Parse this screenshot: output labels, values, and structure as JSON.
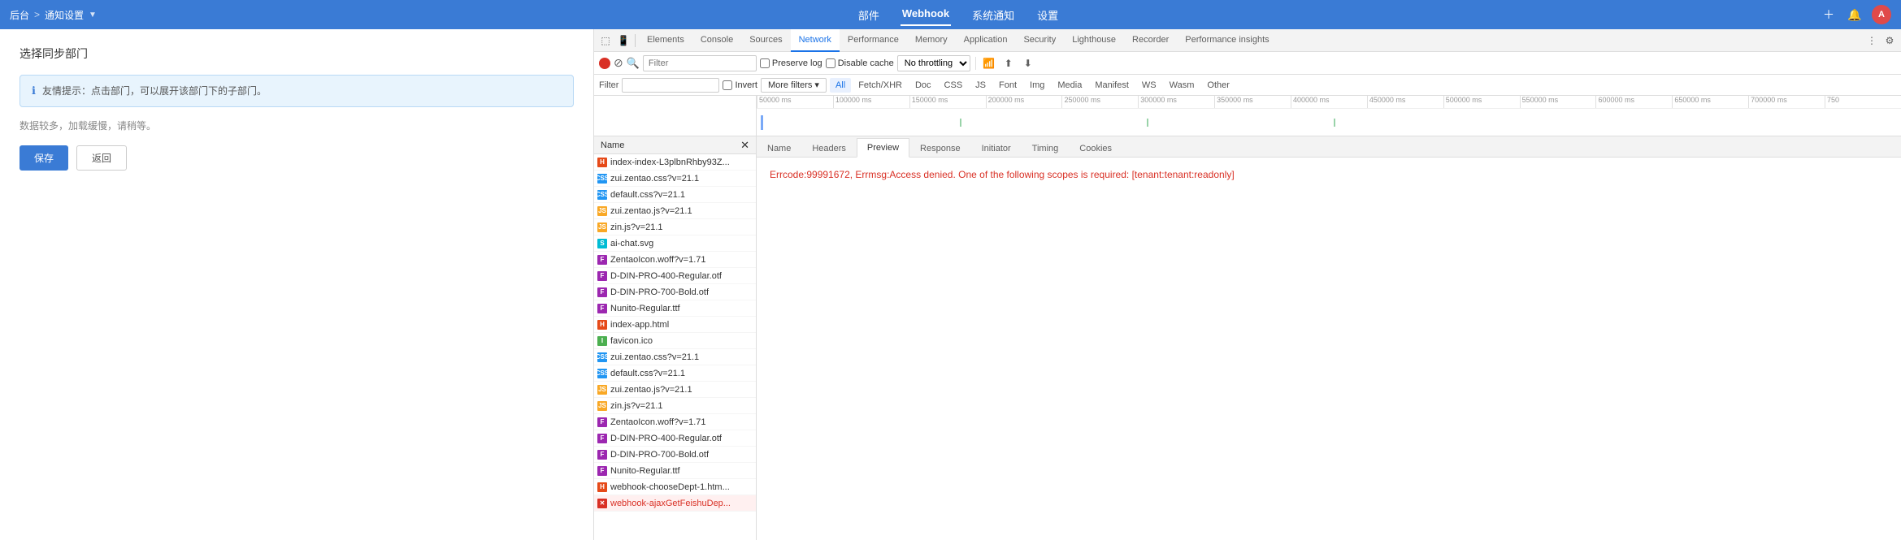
{
  "appBar": {
    "home": "后台",
    "breadcrumb_sep": ">",
    "current_page": "通知设置",
    "dropdown_icon": "▼",
    "nav_items": [
      {
        "label": "部件",
        "active": false
      },
      {
        "label": "Webhook",
        "active": true
      },
      {
        "label": "系统通知",
        "active": false
      },
      {
        "label": "设置",
        "active": false
      }
    ],
    "avatar_text": "A"
  },
  "leftPanel": {
    "title": "选择同步部门",
    "info_text": "友情提示：点击部门，可以展开该部门下的子部门。",
    "loading_text": "数据较多，加载缓慢，请稍等。",
    "save_btn": "保存",
    "back_btn": "返回"
  },
  "devtools": {
    "tabs": [
      {
        "label": "Elements",
        "active": false
      },
      {
        "label": "Console",
        "active": false
      },
      {
        "label": "Sources",
        "active": false
      },
      {
        "label": "Network",
        "active": true
      },
      {
        "label": "Performance",
        "active": false
      },
      {
        "label": "Memory",
        "active": false
      },
      {
        "label": "Application",
        "active": false
      },
      {
        "label": "Security",
        "active": false
      },
      {
        "label": "Lighthouse",
        "active": false
      },
      {
        "label": "Recorder",
        "active": false
      },
      {
        "label": "Performance insights",
        "active": false
      }
    ],
    "toolbar": {
      "preserve_log_label": "Preserve log",
      "disable_cache_label": "Disable cache",
      "throttle_label": "No throttling"
    },
    "filterBar": {
      "filter_label": "Filter",
      "invert_label": "Invert",
      "more_filters_label": "More filters ▾",
      "type_filters": [
        "All",
        "Fetch/XHR",
        "Doc",
        "CSS",
        "JS",
        "Font",
        "Img",
        "Media",
        "Manifest",
        "WS",
        "Wasm",
        "Other"
      ]
    },
    "timeline": {
      "ticks": [
        "50000 ms",
        "100000 ms",
        "150000 ms",
        "200000 ms",
        "250000 ms",
        "300000 ms",
        "350000 ms",
        "400000 ms",
        "450000 ms",
        "500000 ms",
        "550000 ms",
        "600000 ms",
        "650000 ms",
        "700000 ms",
        "750"
      ]
    },
    "nameList": {
      "header": "Name",
      "items": [
        {
          "name": "index-index-L3plbnRhby93Z...",
          "type": "html",
          "error": false
        },
        {
          "name": "zui.zentao.css?v=21.1",
          "type": "css",
          "error": false
        },
        {
          "name": "default.css?v=21.1",
          "type": "css",
          "error": false
        },
        {
          "name": "zui.zentao.js?v=21.1",
          "type": "js",
          "error": false
        },
        {
          "name": "zin.js?v=21.1",
          "type": "js",
          "error": false
        },
        {
          "name": "ai-chat.svg",
          "type": "svg",
          "error": false
        },
        {
          "name": "ZentaoIcon.woff?v=1.71",
          "type": "font",
          "error": false
        },
        {
          "name": "D-DIN-PRO-400-Regular.otf",
          "type": "font",
          "error": false
        },
        {
          "name": "D-DIN-PRO-700-Bold.otf",
          "type": "font",
          "error": false
        },
        {
          "name": "Nunito-Regular.ttf",
          "type": "font",
          "error": false
        },
        {
          "name": "index-app.html",
          "type": "html",
          "error": false
        },
        {
          "name": "favicon.ico",
          "type": "img",
          "error": false
        },
        {
          "name": "zui.zentao.css?v=21.1",
          "type": "css",
          "error": false
        },
        {
          "name": "default.css?v=21.1",
          "type": "css",
          "error": false
        },
        {
          "name": "zui.zentao.js?v=21.1",
          "type": "js",
          "error": false
        },
        {
          "name": "zin.js?v=21.1",
          "type": "js",
          "error": false
        },
        {
          "name": "ZentaoIcon.woff?v=1.71",
          "type": "font",
          "error": false
        },
        {
          "name": "D-DIN-PRO-400-Regular.otf",
          "type": "font",
          "error": false
        },
        {
          "name": "D-DIN-PRO-700-Bold.otf",
          "type": "font",
          "error": false
        },
        {
          "name": "Nunito-Regular.ttf",
          "type": "font",
          "error": false
        },
        {
          "name": "webhook-chooseDept-1.htm...",
          "type": "html",
          "error": false
        },
        {
          "name": "webhook-ajaxGetFeishuDep...",
          "type": "xhr",
          "error": true
        }
      ]
    },
    "previewTabs": [
      "Name",
      "Headers",
      "Preview",
      "Response",
      "Initiator",
      "Timing",
      "Cookies"
    ],
    "activePreviewTab": "Preview",
    "previewContent": "Errcode:99991672, Errmsg:Access denied. One of the following scopes is required: [tenant:tenant:readonly]"
  }
}
